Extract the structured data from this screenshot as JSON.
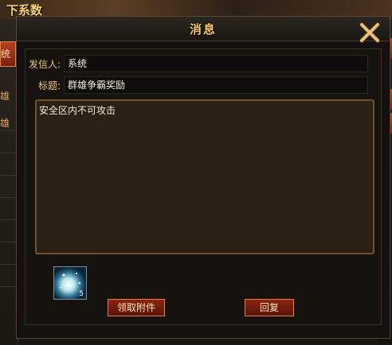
{
  "background": {
    "top_text": "下系数",
    "left_tab": "统",
    "left_items": [
      "雄",
      "雄"
    ]
  },
  "dialog": {
    "title": "消息",
    "sender_label": "发信人:",
    "sender_value": "系统",
    "subject_label": "标题:",
    "subject_value": "群雄争霸奖励",
    "body": "安全区内不可攻击",
    "attachment": {
      "icon": "crystal-item-icon",
      "count": "5"
    },
    "claim_button": "领取附件",
    "reply_button": "回复"
  },
  "colors": {
    "title": "#f3c66b",
    "label": "#e8c582",
    "button": "#8a2410"
  }
}
